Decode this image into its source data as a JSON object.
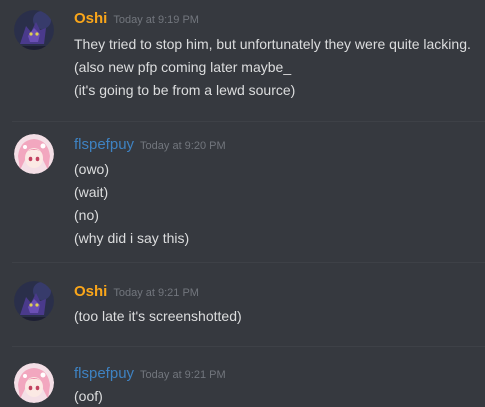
{
  "colors": {
    "background": "#36393f",
    "message_text": "#dcddde",
    "timestamp": "#72767d",
    "divider": "#3e4147"
  },
  "messages": [
    {
      "username": "Oshi",
      "username_color": "#faa61a",
      "avatar": "wolf-avatar-icon",
      "timestamp": "Today at 9:19 PM",
      "lines": [
        "They tried to stop him, but unfortunately they were quite lacking.",
        "(also new pfp coming later maybe_",
        "(it's going to be from a lewd source)"
      ]
    },
    {
      "username": "flspefpuy",
      "username_color": "#3e82c2",
      "avatar": "anime-girl-avatar-icon",
      "timestamp": "Today at 9:20 PM",
      "lines": [
        "(owo)",
        "(wait)",
        "(no)",
        "(why did i say this)"
      ]
    },
    {
      "username": "Oshi",
      "username_color": "#faa61a",
      "avatar": "wolf-avatar-icon",
      "timestamp": "Today at 9:21 PM",
      "lines": [
        "(too late it's screenshotted)"
      ]
    },
    {
      "username": "flspefpuy",
      "username_color": "#3e82c2",
      "avatar": "anime-girl-avatar-icon",
      "timestamp": "Today at 9:21 PM",
      "lines": [
        "(oof)"
      ]
    }
  ]
}
